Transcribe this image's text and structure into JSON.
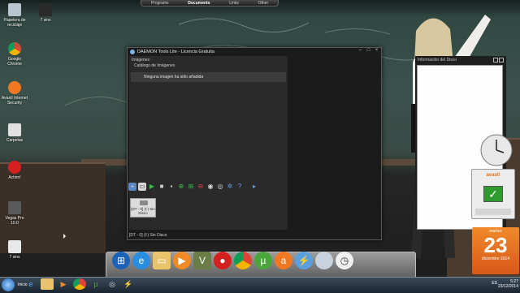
{
  "top_bar": {
    "tabs": [
      "Programs",
      "Documents",
      "Links",
      "Other"
    ],
    "active": "Documents"
  },
  "desktop": {
    "icons": [
      {
        "label": "Papelera de reciclaje",
        "icon": "recycle-bin-icon",
        "color": "#b8c4d0"
      },
      {
        "label": "7 sins",
        "icon": "game-icon",
        "color": "#2a2a2a"
      },
      {
        "label": "Google Chrome",
        "icon": "chrome-icon",
        "color": "#3aa757"
      },
      {
        "label": "Avast! Internet Security",
        "icon": "avast-icon",
        "color": "#f07822"
      },
      {
        "label": "Carpetas",
        "icon": "folder-icon",
        "color": "#e0e0e0"
      },
      {
        "label": "Action!",
        "icon": "record-icon",
        "color": "#d62020"
      },
      {
        "label": "Vegas Pro 10.0",
        "icon": "vegas-icon",
        "color": "#5a5a5a"
      },
      {
        "label": "7 sins",
        "icon": "game-icon",
        "color": "#e8e8e8"
      }
    ]
  },
  "window": {
    "title": "DAEMON Tools Lite - Licencia Gratuita",
    "images_header": "Imágenes",
    "catalog_label": "Catálogo de Imágenes",
    "empty_message": "Ninguna imagen ha sido añadida",
    "disk_info_header": "Información del Disco",
    "drive_label": "[DT - 0] (I:) Sin Disco",
    "status_text": "[DT - 0] (I:) Sin Disco",
    "toolbar_icons": [
      "add-image-icon",
      "new-image-icon",
      "play-icon",
      "stop-icon",
      "square-icon",
      "add-drive-icon",
      "add-scsi-drive-icon",
      "remove-drive-icon",
      "disc-icon",
      "disc-burn-icon",
      "settings-icon",
      "help-icon",
      "more-icon"
    ]
  },
  "dock": {
    "icons": [
      "windows-icon",
      "ie-icon",
      "explorer-icon",
      "media-player-icon",
      "vegas-icon",
      "action-icon",
      "chrome-icon",
      "utorrent-icon",
      "avast-icon",
      "sync-icon",
      "recycle-bin-icon",
      "clock-icon"
    ]
  },
  "taskbar": {
    "start_label": "Inicio",
    "language": "ES",
    "time": "5:27",
    "date": "23/12/2014"
  },
  "calendar_gadget": {
    "weekday": "martes",
    "day": "23",
    "month_year": "diciembre 2014"
  },
  "avast_gadget": {
    "brand": "avast!"
  },
  "colors": {
    "accent": "#e66e14",
    "calendar": "#e8721f",
    "window_bg": "#1b1b1b"
  }
}
